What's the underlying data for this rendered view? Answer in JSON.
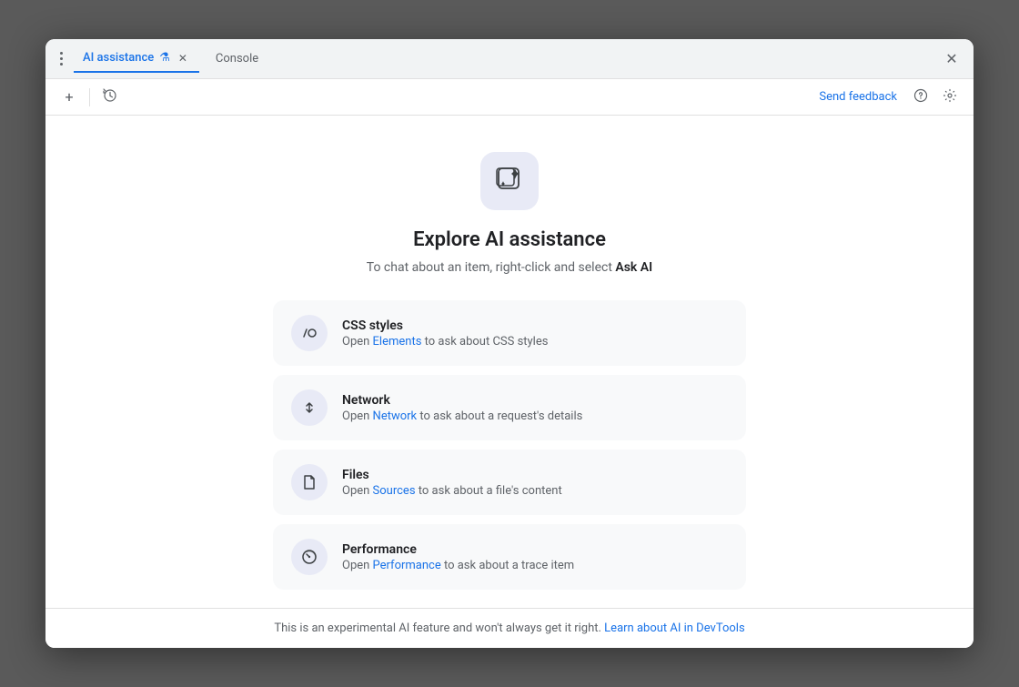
{
  "window": {
    "title": "AI assistance"
  },
  "titlebar": {
    "tab_active_label": "AI assistance",
    "tab_active_icon": "flask-icon",
    "tab_inactive_label": "Console",
    "close_label": "×"
  },
  "toolbar": {
    "new_tab_label": "+",
    "history_icon": "history-icon",
    "send_feedback_label": "Send feedback",
    "help_icon": "help-icon",
    "settings_icon": "settings-icon"
  },
  "main": {
    "explore_title": "Explore AI assistance",
    "explore_subtitle_plain": "To chat about an item, right-click and select ",
    "explore_subtitle_bold": "Ask AI",
    "cards": [
      {
        "id": "css-styles",
        "title": "CSS styles",
        "desc_prefix": "Open ",
        "link_label": "Elements",
        "desc_suffix": " to ask about CSS styles"
      },
      {
        "id": "network",
        "title": "Network",
        "desc_prefix": "Open ",
        "link_label": "Network",
        "desc_suffix": " to ask about a request's details"
      },
      {
        "id": "files",
        "title": "Files",
        "desc_prefix": "Open ",
        "link_label": "Sources",
        "desc_suffix": " to ask about a file's content"
      },
      {
        "id": "performance",
        "title": "Performance",
        "desc_prefix": "Open ",
        "link_label": "Performance",
        "desc_suffix": " to ask about a trace item"
      }
    ]
  },
  "footer": {
    "text_prefix": "This is an experimental AI feature and won't always get it right. ",
    "link_label": "Learn about AI in DevTools"
  },
  "colors": {
    "accent": "#1a73e8",
    "text_primary": "#202124",
    "text_secondary": "#5f6368",
    "bg_card": "#f8f9fa",
    "bg_icon": "#e8eaf6"
  }
}
